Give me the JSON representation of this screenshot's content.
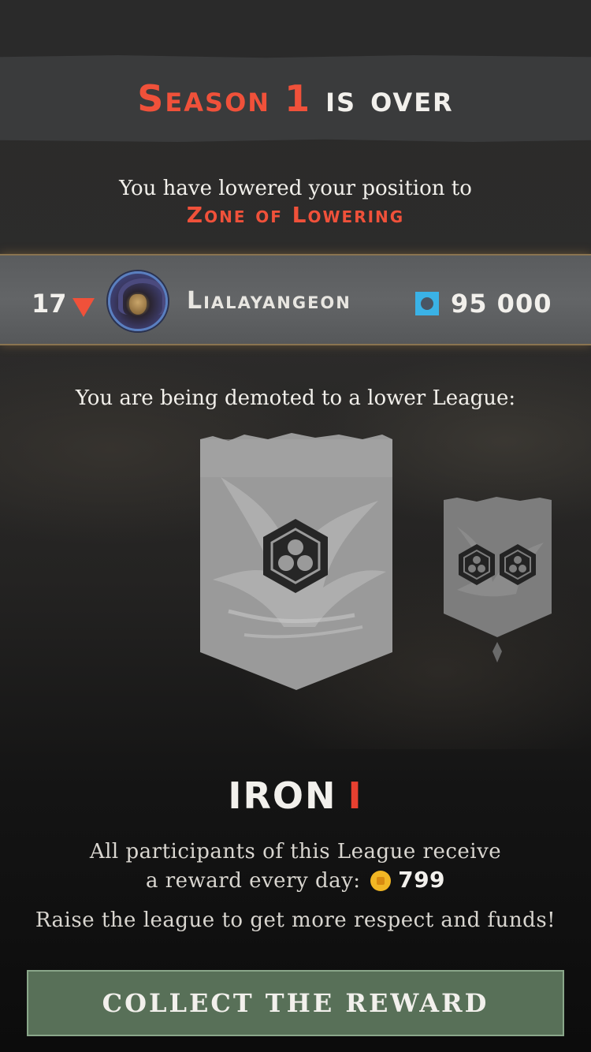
{
  "header": {
    "title_highlight": "Season 1",
    "title_rest": "is over"
  },
  "result": {
    "message": "You have lowered your position to",
    "zone": "Zone of Lowering"
  },
  "player": {
    "rank": "17",
    "rank_trend": "down",
    "name": "Lialayangeon",
    "rating": "95 000",
    "avatar_icon": "hooded-skull-avatar",
    "rating_icon": "blue-square-rating-icon"
  },
  "demotion": {
    "message": "You are being demoted to a lower League:"
  },
  "league": {
    "name": "IRON",
    "tier": "I",
    "reward_line1": "All participants of this League receive",
    "reward_line2": "a reward every day:",
    "reward_amount": "799",
    "reward_icon": "gold-coin-icon",
    "hint": "Raise the league to get more respect and funds!"
  },
  "actions": {
    "collect_label": "COLLECT THE REWARD"
  },
  "colors": {
    "accent_red": "#f0513a",
    "button_green": "#587058",
    "rating_blue": "#3ab2e6",
    "coin_gold": "#f2b724"
  }
}
